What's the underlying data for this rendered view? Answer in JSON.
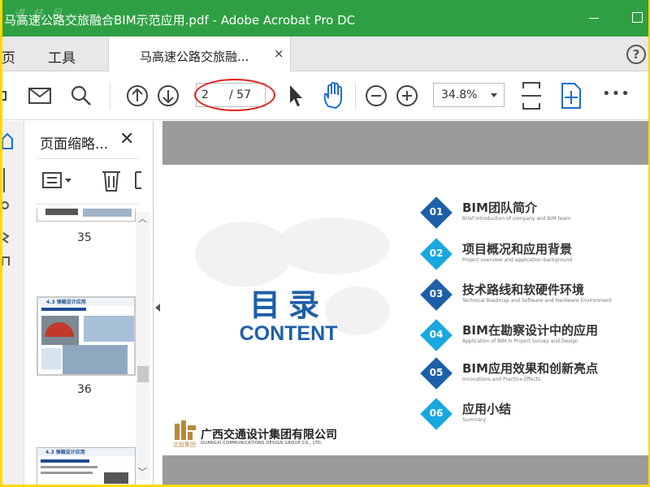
{
  "window": {
    "title": "马高速公路交旅融合BIM示范应用.pdf - Adobe Acrobat Pro DC",
    "watermark": "道 技 风"
  },
  "tabbar": {
    "home": "主页",
    "tools": "工具",
    "doc_tab": "马高速公路交旅融...",
    "close": "×",
    "help": "?"
  },
  "toolbar": {
    "page_current": "2",
    "page_total": "/ 57",
    "zoom": "34.8%",
    "more": "•••"
  },
  "thumbnails": {
    "title": "页面缩略...",
    "close": "✕",
    "pages": [
      {
        "number": "35"
      },
      {
        "number": "36",
        "heading": "4.3 弹箱设计应用"
      },
      {
        "heading": "4.3 弹箱设计应用"
      }
    ]
  },
  "page": {
    "title_zh": "目录",
    "title_en": "CONTENT",
    "company_zh": "广西交通设计集团有限公司",
    "company_en": "GUANGXI COMMUNICATIONS DESIGN GROUP CO., LTD.",
    "logo_sub": "北投集团",
    "items": [
      {
        "num": "01",
        "zh": "BIM团队简介",
        "en": "Brief introduction of company and BIM team",
        "color": "#1d5fa9"
      },
      {
        "num": "02",
        "zh": "项目概况和应用背景",
        "en": "Project overview and application background",
        "color": "#19a7e0"
      },
      {
        "num": "03",
        "zh": "技术路线和软硬件环境",
        "en": "Technical Roadmap and Software and Hardware Environment",
        "color": "#1d5fa9"
      },
      {
        "num": "04",
        "zh": "BIM在勘察设计中的应用",
        "en": "Application of BIM in Project Survey and Design",
        "color": "#19a7e0"
      },
      {
        "num": "05",
        "zh": "BIM应用效果和创新亮点",
        "en": "Innovations and Practice Effects",
        "color": "#1d5fa9"
      },
      {
        "num": "06",
        "zh": "应用小结",
        "en": "Summary",
        "color": "#19a7e0"
      }
    ]
  },
  "colors": {
    "titlebar": "#2ea043",
    "accent_dark": "#1d5fa9",
    "accent_light": "#19a7e0",
    "annotation": "#e0201c"
  }
}
